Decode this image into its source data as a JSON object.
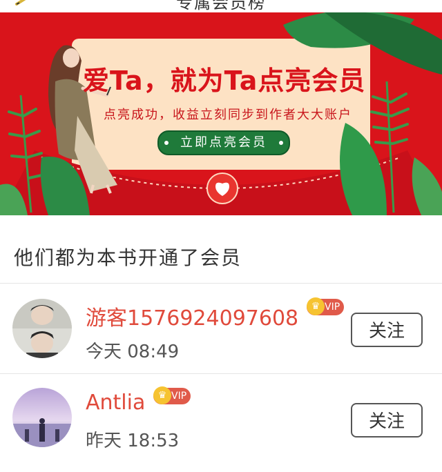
{
  "header": {
    "title": "专属会员榜"
  },
  "banner": {
    "headline": "爱Ta，就为Ta点亮会员",
    "subtitle": "点亮成功，收益立刻同步到作者大大账户",
    "cta_label": "立即点亮会员",
    "colors": {
      "red": "#d9141b",
      "green": "#1f7a3a",
      "card": "#fde2c4"
    }
  },
  "section": {
    "title": "他们都为本书开通了会员"
  },
  "members": [
    {
      "name": "游客1576924097608",
      "badge": "VIP",
      "time": "今天 08:49",
      "follow_label": "关注",
      "avatar_icon": "photo-avatar-icon"
    },
    {
      "name": "Antlia",
      "badge": "VIP",
      "time": "昨天 18:53",
      "follow_label": "关注",
      "avatar_icon": "landscape-avatar-icon"
    }
  ]
}
